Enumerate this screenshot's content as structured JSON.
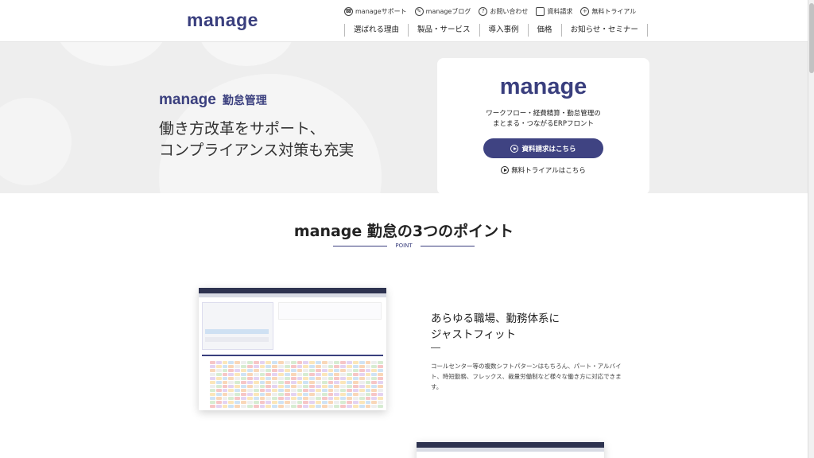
{
  "header": {
    "logo": "manage",
    "util_links": [
      {
        "icon": "support-icon",
        "label": "manageサポート"
      },
      {
        "icon": "blog-icon",
        "label": "manageブログ"
      },
      {
        "icon": "question-icon",
        "label": "お問い合わせ"
      },
      {
        "icon": "document-icon",
        "label": "資料請求"
      },
      {
        "icon": "trial-icon",
        "label": "無料トライアル"
      }
    ],
    "nav": [
      "選ばれる理由",
      "製品・サービス",
      "導入事例",
      "価格",
      "お知らせ・セミナー"
    ]
  },
  "hero": {
    "brand_logo": "manage",
    "brand_sub": "勤怠管理",
    "headline_1": "働き方改革をサポート、",
    "headline_2": "コンプライアンス対策も充実",
    "card": {
      "logo": "manage",
      "desc_1": "ワークフロー・経費精算・勤怠管理の",
      "desc_2": "まとまる・つながるERPフロント",
      "button": "資料請求はこちら",
      "link": "無料トライアルはこちら"
    }
  },
  "points": {
    "title": "manage 勤怠の3つのポイント",
    "label": "POINT",
    "feature_1": {
      "title_1": "あらゆる職場、勤務体系に",
      "title_2": "ジャストフィット",
      "text": "コールセンター等の複数シフトパターンはもちろん、パート・アルバイト、時短勤務、フレックス、裁量労働制など様々な働き方に対応できます。"
    }
  },
  "colors": {
    "brand": "#3a3f7e",
    "button": "#3f4382",
    "hero_bg": "#eeeeee"
  }
}
